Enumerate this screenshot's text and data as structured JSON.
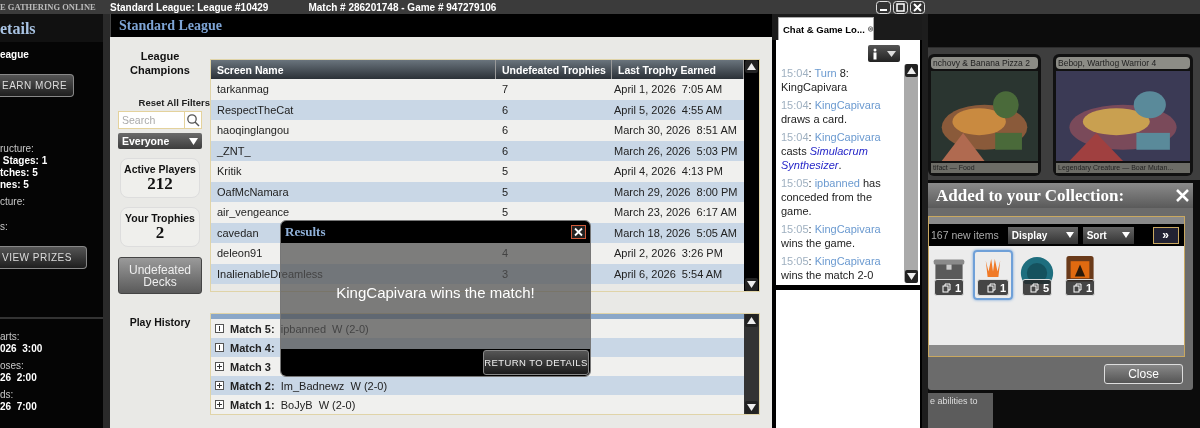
{
  "title_bar": {
    "brand": "E GATHERING ONLINE",
    "league": "Standard League: League #10429",
    "match": "Match # 286201748 - Game # 947279106"
  },
  "left_panel": {
    "title": "etails",
    "top": [
      {
        "kind": "value",
        "text": "eague"
      },
      {
        "kind": "button",
        "text": "EARN MORE"
      },
      {
        "kind": "label",
        "text": "ructure:"
      },
      {
        "kind": "value",
        "text": " Stages: 1"
      },
      {
        "kind": "value",
        "text": "tches: 5"
      },
      {
        "kind": "value",
        "text": "nes: 5"
      },
      {
        "kind": "label",
        "text": "cture:"
      },
      {
        "kind": "label",
        "text": "s:"
      },
      {
        "kind": "button",
        "text": "VIEW PRIZES"
      }
    ],
    "bottom": [
      {
        "kind": "label",
        "text": "arts:"
      },
      {
        "kind": "value",
        "text": "026  3:00"
      },
      {
        "kind": "label",
        "text": "oses:"
      },
      {
        "kind": "value",
        "text": "26  2:00"
      },
      {
        "kind": "label",
        "text": "ds:"
      },
      {
        "kind": "value",
        "text": "26  7:00"
      }
    ]
  },
  "league": {
    "title": "Standard League",
    "champions_label": "League Champions",
    "reset_filters": "Reset All Filters",
    "search": {
      "placeholder": "Search"
    },
    "filter": "Everyone",
    "stats": [
      {
        "label": "Active Players",
        "value": "212"
      },
      {
        "label": "Your Trophies",
        "value": "2"
      }
    ],
    "undefeated_button": "Undefeated Decks",
    "play_history_label": "Play History",
    "table": {
      "columns": [
        "Screen Name",
        "Undefeated Trophies",
        "Last Trophy Earned"
      ],
      "rows": [
        {
          "name": "tarkanmag",
          "trophies": "7",
          "last": "April 1, 2026  7:05 AM"
        },
        {
          "name": "RespectTheCat",
          "trophies": "6",
          "last": "April 5, 2026  4:55 AM"
        },
        {
          "name": "haoqinglangou",
          "trophies": "6",
          "last": "March 30, 2026  8:51 AM"
        },
        {
          "name": "_ZNT_",
          "trophies": "6",
          "last": "March 26, 2026  5:03 PM"
        },
        {
          "name": "Kritik",
          "trophies": "5",
          "last": "April 4, 2026  4:13 PM"
        },
        {
          "name": "OafMcNamara",
          "trophies": "5",
          "last": "March 29, 2026  8:00 PM"
        },
        {
          "name": "air_vengeance",
          "trophies": "5",
          "last": "March 23, 2026  6:17 AM"
        },
        {
          "name": "cavedan",
          "last": "March 18, 2026  5:05 AM"
        },
        {
          "name": "deleon91",
          "trophies": "4",
          "last": "April 2, 2026  3:26 PM"
        },
        {
          "name": "InalienableDreamless",
          "trophies": "3",
          "last": "April 6, 2026  5:54 AM"
        }
      ]
    },
    "history": [
      {
        "label": "Match 5:",
        "opponent": "ipbanned",
        "result": "W (2-0)",
        "expanded": true
      },
      {
        "label": "Match 4:",
        "expanded": true
      },
      {
        "label": "Match 3",
        "expanded": false
      },
      {
        "label": "Match 2:",
        "opponent": "Im_Badnewz",
        "result": "W (2-0)",
        "expanded": false
      },
      {
        "label": "Match 1:",
        "opponent": "BoJyB",
        "result": "W (2-0)",
        "expanded": false
      }
    ]
  },
  "results_dialog": {
    "title": "Results",
    "message": "KingCapivara wins the match!",
    "button": "RETURN TO DETAILS"
  },
  "chat": {
    "tab": "Chat & Game Lo...",
    "messages": [
      [
        {
          "kind": "time",
          "text": "15:04"
        },
        {
          "kind": "plain",
          "text": ": "
        },
        {
          "kind": "player",
          "text": "Turn"
        },
        {
          "kind": "plain",
          "text": " 8: KingCapivara"
        }
      ],
      [
        {
          "kind": "time",
          "text": "15:04"
        },
        {
          "kind": "plain",
          "text": ": "
        },
        {
          "kind": "player",
          "text": "KingCapivara"
        },
        {
          "kind": "plain",
          "text": " draws a card."
        }
      ],
      [
        {
          "kind": "time",
          "text": "15:04"
        },
        {
          "kind": "plain",
          "text": ": "
        },
        {
          "kind": "player",
          "text": "KingCapivara"
        },
        {
          "kind": "plain",
          "text": " casts "
        },
        {
          "kind": "card",
          "text": "Simulacrum Synthesizer"
        },
        {
          "kind": "plain",
          "text": "."
        }
      ],
      [
        {
          "kind": "time",
          "text": "15:05"
        },
        {
          "kind": "plain",
          "text": ": "
        },
        {
          "kind": "player",
          "text": "ipbanned"
        },
        {
          "kind": "plain",
          "text": " has conceded from the game."
        }
      ],
      [
        {
          "kind": "time",
          "text": "15:05"
        },
        {
          "kind": "plain",
          "text": ": "
        },
        {
          "kind": "player",
          "text": "KingCapivara"
        },
        {
          "kind": "plain",
          "text": " wins the game."
        }
      ],
      [
        {
          "kind": "time",
          "text": "15:05"
        },
        {
          "kind": "plain",
          "text": ": "
        },
        {
          "kind": "player",
          "text": "KingCapivara"
        },
        {
          "kind": "plain",
          "text": " wins the match 2-0"
        }
      ]
    ]
  },
  "cards": [
    {
      "name": "nchovy & Banana Pizza 2",
      "type": "tifact — Food"
    },
    {
      "name": "Bebop, Warthog Warrior  4",
      "type": "Legendary Creature — Boar Mutan..."
    }
  ],
  "collection": {
    "title": "Added to your Collection:",
    "count": "167 new items",
    "display": "Display",
    "sort": "Sort",
    "next": "»",
    "items": [
      {
        "kind": "chest",
        "count": "1",
        "selected": false
      },
      {
        "kind": "planeswalker",
        "count": "1",
        "selected": true
      },
      {
        "kind": "disc",
        "count": "5",
        "selected": false
      },
      {
        "kind": "pack",
        "count": "1",
        "selected": false
      }
    ],
    "close": "Close"
  },
  "background_text": "e abilities to"
}
